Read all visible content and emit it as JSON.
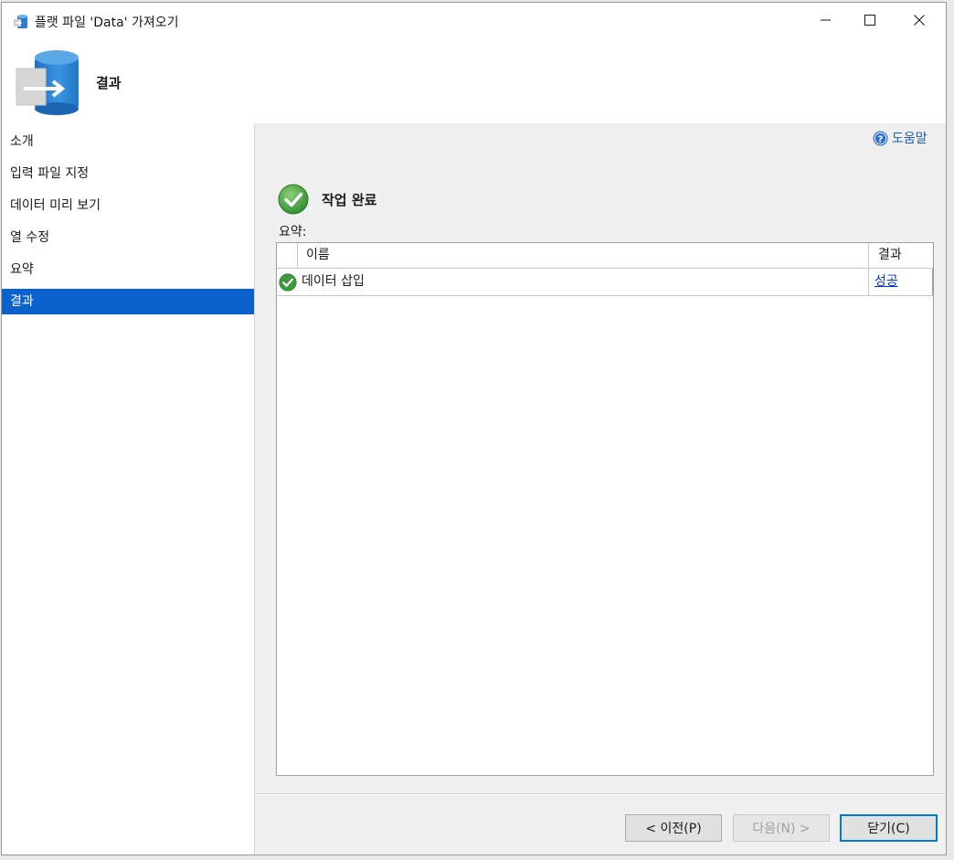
{
  "window": {
    "title": "플랫 파일 'Data' 가져오기"
  },
  "header": {
    "title": "결과"
  },
  "sidebar": {
    "items": [
      {
        "label": "소개"
      },
      {
        "label": "입력 파일 지정"
      },
      {
        "label": "데이터 미리 보기"
      },
      {
        "label": "열 수정"
      },
      {
        "label": "요약"
      },
      {
        "label": "결과",
        "active": true
      }
    ]
  },
  "main": {
    "help_label": "도움말",
    "status": "작업 완료",
    "summary_label": "요약:",
    "grid": {
      "columns": [
        "이름",
        "결과"
      ],
      "rows": [
        {
          "name": "데이터 삽입",
          "result": "성공"
        }
      ]
    }
  },
  "buttons": {
    "previous": "< 이전(P)",
    "next": "다음(N) >",
    "close": "닫기(C)"
  },
  "colors": {
    "accent": "#0b62cc",
    "link": "#0033cc",
    "success": "#3c9a3c"
  }
}
